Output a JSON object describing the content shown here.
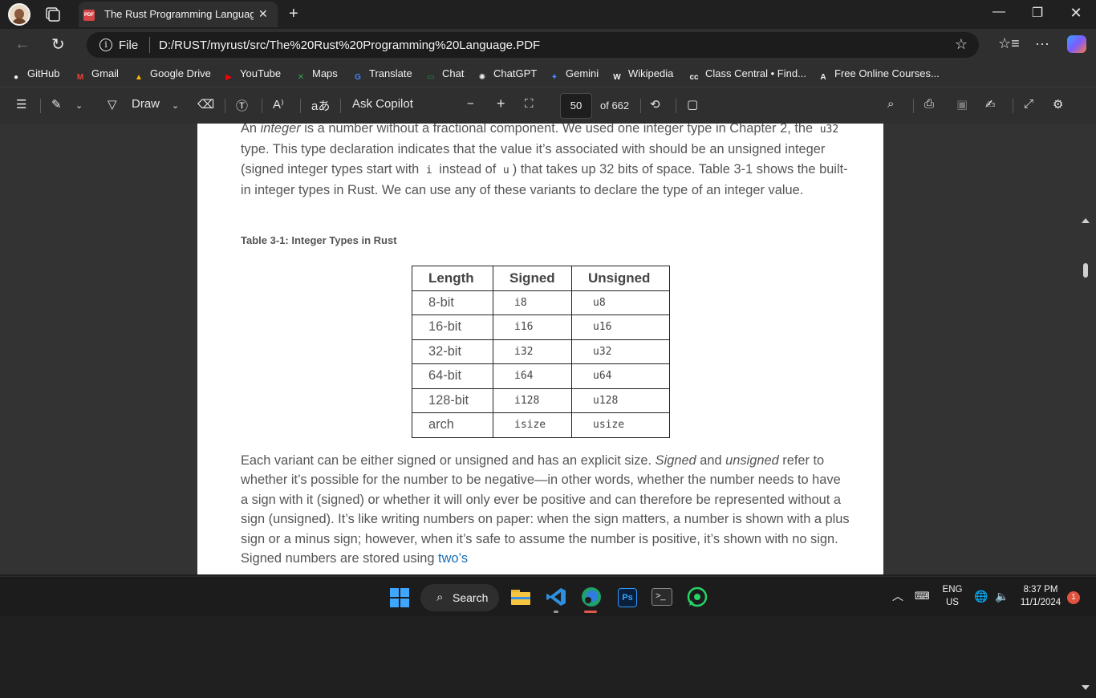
{
  "browser": {
    "tab_title": "The Rust Programming Language",
    "tab_icon_text": "PDF",
    "address_scheme": "File",
    "url": "D:/RUST/myrust/src/The%20Rust%20Programming%20Language.PDF"
  },
  "bookmarks": [
    {
      "label": "GitHub",
      "icon": "github-icon",
      "color": "#f2f2f2"
    },
    {
      "label": "Gmail",
      "icon": "gmail-icon",
      "color": "#ea4335"
    },
    {
      "label": "Google Drive",
      "icon": "google-drive-icon",
      "color": "#fbbc04"
    },
    {
      "label": "YouTube",
      "icon": "youtube-icon",
      "color": "#ff0000"
    },
    {
      "label": "Maps",
      "icon": "maps-icon",
      "color": "#34a853"
    },
    {
      "label": "Translate",
      "icon": "translate-icon",
      "color": "#4285f4"
    },
    {
      "label": "Chat",
      "icon": "chat-icon",
      "color": "#1e8e3e"
    },
    {
      "label": "ChatGPT",
      "icon": "chatgpt-icon",
      "color": "#f2f2f2"
    },
    {
      "label": "Gemini",
      "icon": "gemini-icon",
      "color": "#4f8cff"
    },
    {
      "label": "Wikipedia",
      "icon": "wikipedia-icon",
      "color": "#f2f2f2"
    },
    {
      "label": "Class Central • Find...",
      "icon": "class-central-icon",
      "color": "#f2f2f2"
    },
    {
      "label": "Free Online Courses...",
      "icon": "courses-icon",
      "color": "#f2f2f2"
    }
  ],
  "pdf_toolbar": {
    "draw_label": "Draw",
    "ask_copilot_label": "Ask Copilot",
    "current_page": "50",
    "page_total": "of 662"
  },
  "document": {
    "para1_a": "An ",
    "para1_integer": "integer",
    "para1_b": " is a number without a fractional component. We used one integer type in Chapter 2, the ",
    "para1_u32": "u32",
    "para1_c": " type. This type declaration indicates that the value it’s associated with should be an unsigned integer (signed integer types start with ",
    "para1_i": "i",
    "para1_d": " instead of ",
    "para1_u": "u",
    "para1_e": ") that takes up 32 bits of space. Table 3-1 shows the built-in integer types in Rust. We can use any of these variants to declare the type of an integer value.",
    "table_caption": "Table 3-1: Integer Types in Rust",
    "table_headers": [
      "Length",
      "Signed",
      "Unsigned"
    ],
    "table_rows": [
      [
        "8-bit",
        "i8",
        "u8"
      ],
      [
        "16-bit",
        "i16",
        "u16"
      ],
      [
        "32-bit",
        "i32",
        "u32"
      ],
      [
        "64-bit",
        "i64",
        "u64"
      ],
      [
        "128-bit",
        "i128",
        "u128"
      ],
      [
        "arch",
        "isize",
        "usize"
      ]
    ],
    "para2_a": "Each variant can be either signed or unsigned and has an explicit size. ",
    "para2_signed": "Signed",
    "para2_and": " and ",
    "para2_unsigned": "unsigned",
    "para2_b": " refer to whether it’s possible for the number to be negative—in other words, whether the number needs to have a sign with it (signed) or whether it will only ever be positive and can therefore be represented without a sign (unsigned). It’s like writing numbers on paper: when the sign matters, a number is shown with a plus sign or a minus sign; however, when it’s safe to assume the number is positive, it’s shown with no sign. Signed numbers are stored using ",
    "para2_link": "two’s",
    "link_color": "#1a6fb5"
  },
  "taskbar": {
    "search_label": "Search",
    "lang_line1": "ENG",
    "lang_line2": "US",
    "time": "8:37 PM",
    "date": "11/1/2024",
    "notification_count": "1"
  }
}
